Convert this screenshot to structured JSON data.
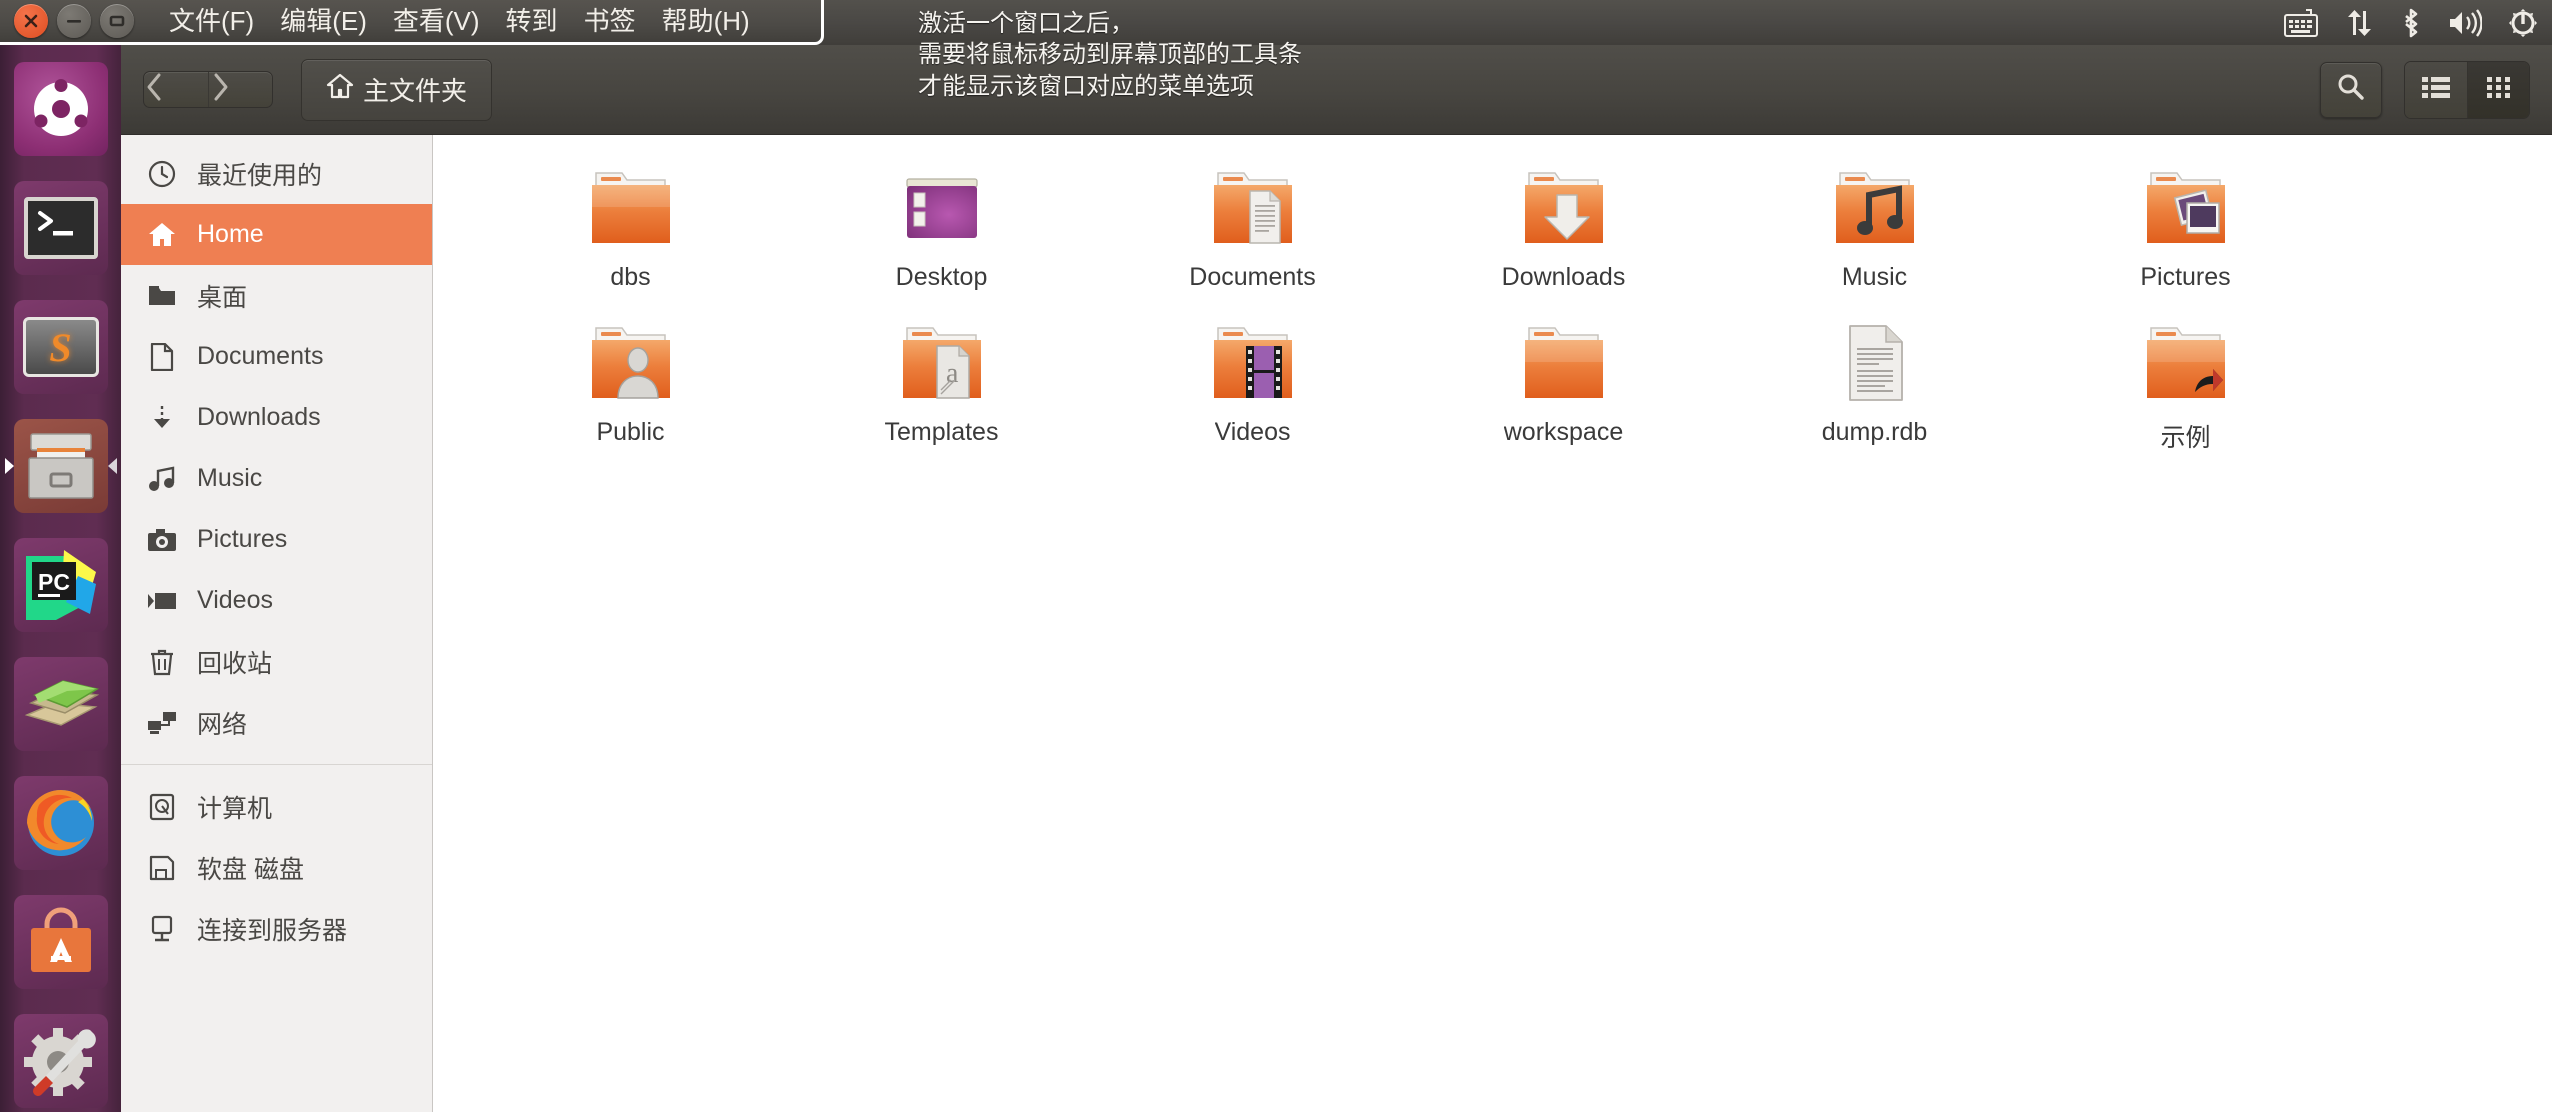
{
  "top_panel": {
    "window_controls": [
      {
        "name": "close",
        "glyph": "✕"
      },
      {
        "name": "minimize",
        "glyph": "−"
      },
      {
        "name": "maximize",
        "glyph": "□"
      }
    ],
    "menus": [
      {
        "label": "文件(F)"
      },
      {
        "label": "编辑(E)"
      },
      {
        "label": "查看(V)"
      },
      {
        "label": "转到"
      },
      {
        "label": "书签"
      },
      {
        "label": "帮助(H)"
      }
    ],
    "annotation": "激活一个窗口之后，\n需要将鼠标移动到屏幕顶部的工具条\n才能显示该窗口对应的菜单选项",
    "tray": [
      {
        "name": "keyboard-indicator-icon"
      },
      {
        "name": "network-icon"
      },
      {
        "name": "bluetooth-icon"
      },
      {
        "name": "volume-icon"
      },
      {
        "name": "system-menu-gear-icon"
      }
    ]
  },
  "launcher": {
    "items": [
      {
        "name": "dash-ubuntu-button",
        "label": "Ubuntu Dash",
        "running": false
      },
      {
        "name": "terminal-button",
        "label": "Terminal",
        "running": false
      },
      {
        "name": "sublime-text-button",
        "label": "Sublime Text",
        "running": false
      },
      {
        "name": "files-button",
        "label": "Files",
        "running": true
      },
      {
        "name": "pycharm-button",
        "label": "PyCharm",
        "running": false
      },
      {
        "name": "help-books-button",
        "label": "Help",
        "running": false
      },
      {
        "name": "firefox-button",
        "label": "Firefox",
        "running": false
      },
      {
        "name": "software-center-button",
        "label": "Ubuntu Software",
        "running": false
      },
      {
        "name": "system-settings-button",
        "label": "System Settings",
        "running": false
      }
    ]
  },
  "toolbar": {
    "back_icon": "‹",
    "forward_icon": "›",
    "breadcrumb_label": "主文件夹",
    "breadcrumb_icon": "home-icon",
    "search_icon": "search-icon",
    "list_view_icon": "list-view-icon",
    "grid_view_icon": "grid-view-icon",
    "active_view": "grid"
  },
  "sidebar": {
    "groups": [
      {
        "items": [
          {
            "label": "最近使用的",
            "icon": "clock-icon",
            "active": false
          },
          {
            "label": "Home",
            "icon": "home-icon",
            "active": true
          },
          {
            "label": "桌面",
            "icon": "folder-icon",
            "active": false
          },
          {
            "label": "Documents",
            "icon": "document-icon",
            "active": false
          },
          {
            "label": "Downloads",
            "icon": "download-icon",
            "active": false
          },
          {
            "label": "Music",
            "icon": "music-note-icon",
            "active": false
          },
          {
            "label": "Pictures",
            "icon": "camera-icon",
            "active": false
          },
          {
            "label": "Videos",
            "icon": "video-icon",
            "active": false
          },
          {
            "label": "回收站",
            "icon": "trash-icon",
            "active": false
          },
          {
            "label": "网络",
            "icon": "network-icon",
            "active": false
          }
        ]
      },
      {
        "items": [
          {
            "label": "计算机",
            "icon": "computer-icon",
            "active": false
          },
          {
            "label": "软盘 磁盘",
            "icon": "floppy-disk-icon",
            "active": false
          },
          {
            "label": "连接到服务器",
            "icon": "server-connect-icon",
            "active": false
          }
        ]
      }
    ]
  },
  "content": {
    "files": [
      {
        "label": "dbs",
        "type": "folder",
        "variant": "plain"
      },
      {
        "label": "Desktop",
        "type": "folder",
        "variant": "desktop"
      },
      {
        "label": "Documents",
        "type": "folder",
        "variant": "documents"
      },
      {
        "label": "Downloads",
        "type": "folder",
        "variant": "downloads"
      },
      {
        "label": "Music",
        "type": "folder",
        "variant": "music"
      },
      {
        "label": "Pictures",
        "type": "folder",
        "variant": "pictures"
      },
      {
        "label": "Public",
        "type": "folder",
        "variant": "public"
      },
      {
        "label": "Templates",
        "type": "folder",
        "variant": "templates"
      },
      {
        "label": "Videos",
        "type": "folder",
        "variant": "videos"
      },
      {
        "label": "workspace",
        "type": "folder",
        "variant": "plain"
      },
      {
        "label": "dump.rdb",
        "type": "file",
        "variant": "text-document"
      },
      {
        "label": "示例",
        "type": "folder",
        "variant": "symlink"
      }
    ]
  },
  "colors": {
    "accent_orange": "#ef7f52",
    "panel_dark": "#474540",
    "launcher_purple": "#5b2b4e",
    "folder_orange": "#e8703a",
    "sidebar_bg": "#f2f0ef"
  }
}
